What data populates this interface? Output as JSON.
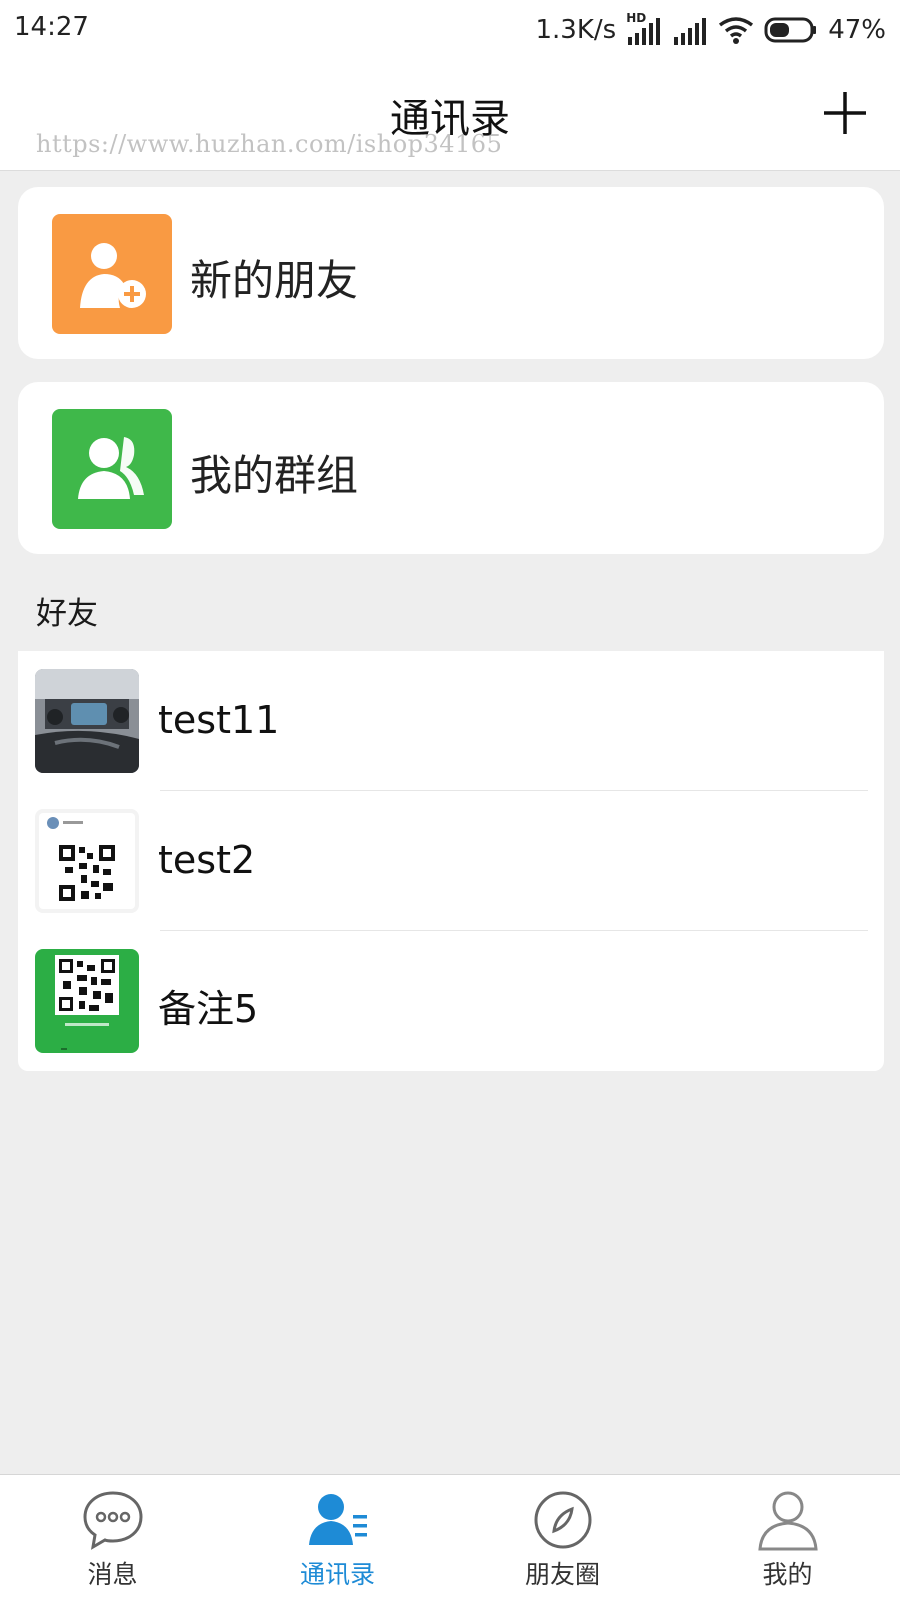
{
  "status_bar": {
    "time": "14:27",
    "net_speed": "1.3K/s",
    "hd_label": "HD",
    "battery": "47%"
  },
  "nav": {
    "title": "通讯录",
    "watermark": "https://www.huzhan.com/ishop34165"
  },
  "cards": {
    "new_friends": "新的朋友",
    "my_groups": "我的群组"
  },
  "friends_section": {
    "title": "好友",
    "items": [
      {
        "name": "test11"
      },
      {
        "name": "test2"
      },
      {
        "name": "备注5"
      }
    ]
  },
  "tabs": [
    {
      "label": "消息",
      "active": false
    },
    {
      "label": "通讯录",
      "active": true
    },
    {
      "label": "朋友圈",
      "active": false
    },
    {
      "label": "我的",
      "active": false
    }
  ],
  "colors": {
    "orange_icon_bg": "#f99a43",
    "green_icon_bg": "#3fb84a",
    "active_tab": "#1e8bd6",
    "page_bg": "#eeeeee"
  }
}
